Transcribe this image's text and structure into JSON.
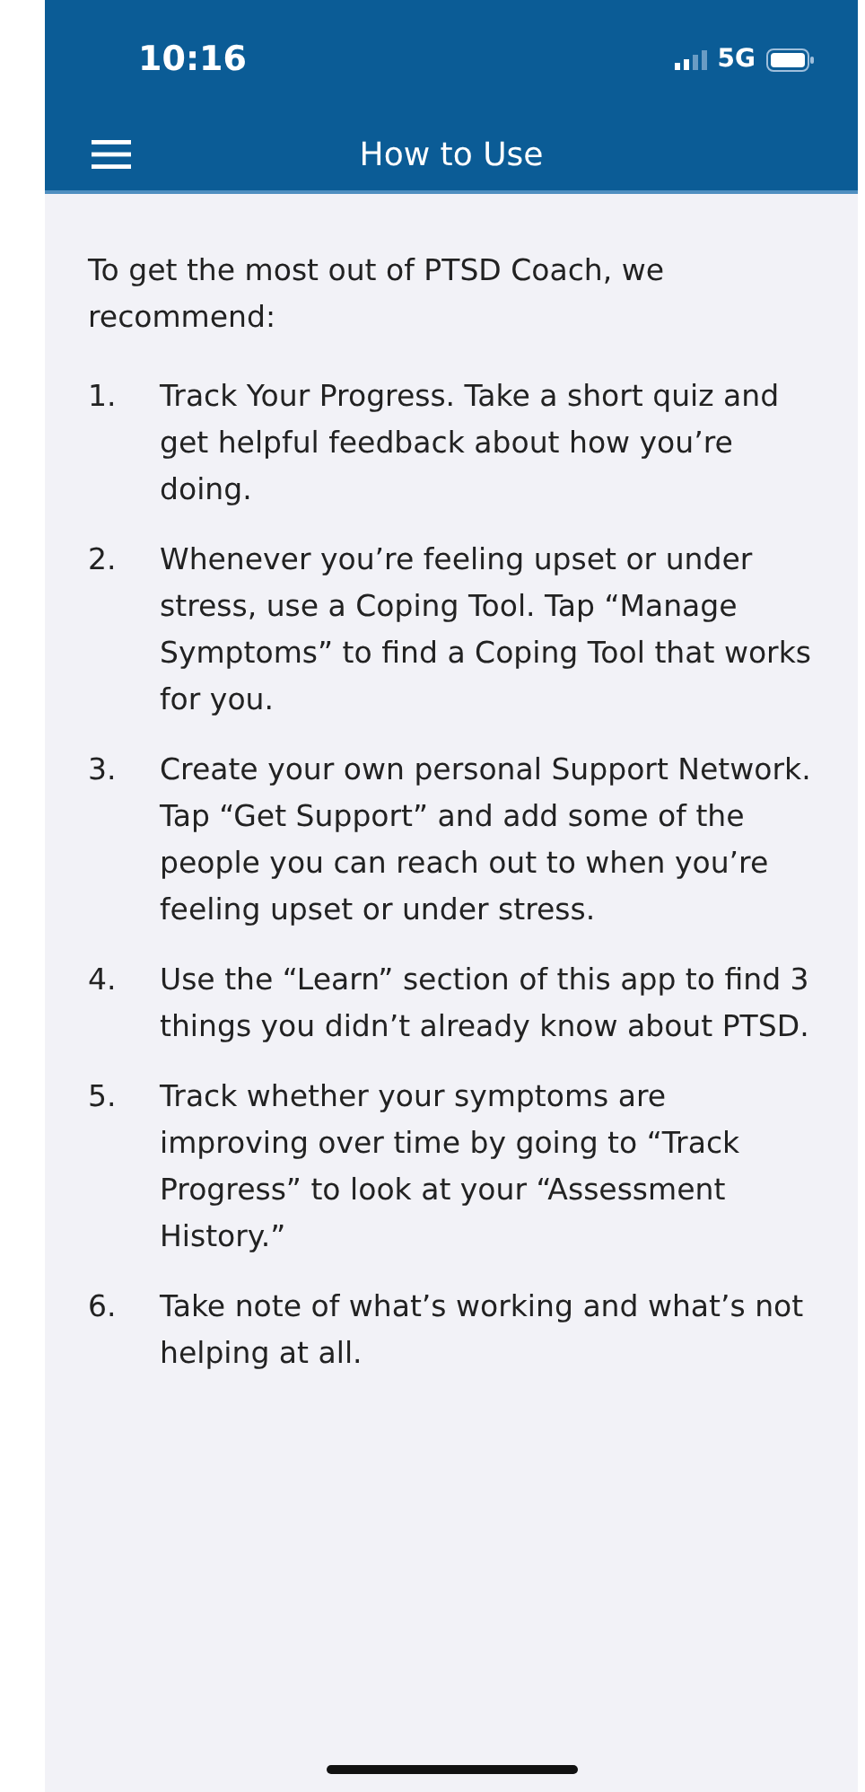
{
  "status_bar": {
    "time": "10:16",
    "network": "5G"
  },
  "nav": {
    "title": "How to Use"
  },
  "intro": "To get the most out of PTSD Coach, we recommend:",
  "steps": [
    {
      "number": "1.",
      "text": "Track Your Progress. Take a short quiz and get helpful feedback about how you’re doing."
    },
    {
      "number": "2.",
      "text": "Whenever you’re feeling upset or under stress, use a Coping Tool. Tap “Manage Symptoms” to find a Coping Tool that works for you."
    },
    {
      "number": "3.",
      "text": "Create your own personal Support Network. Tap “Get Support” and add some of the people you can reach out to when you’re feeling upset or under stress."
    },
    {
      "number": "4.",
      "text": "Use the “Learn” section of this app to find 3 things you didn’t already know about PTSD."
    },
    {
      "number": "5.",
      "text": "Track whether your symptoms are improving over time by going to “Track Progress” to look at your “Assessment History.”"
    },
    {
      "number": "6.",
      "text": "Take note of what’s working and what’s not helping at all."
    }
  ]
}
